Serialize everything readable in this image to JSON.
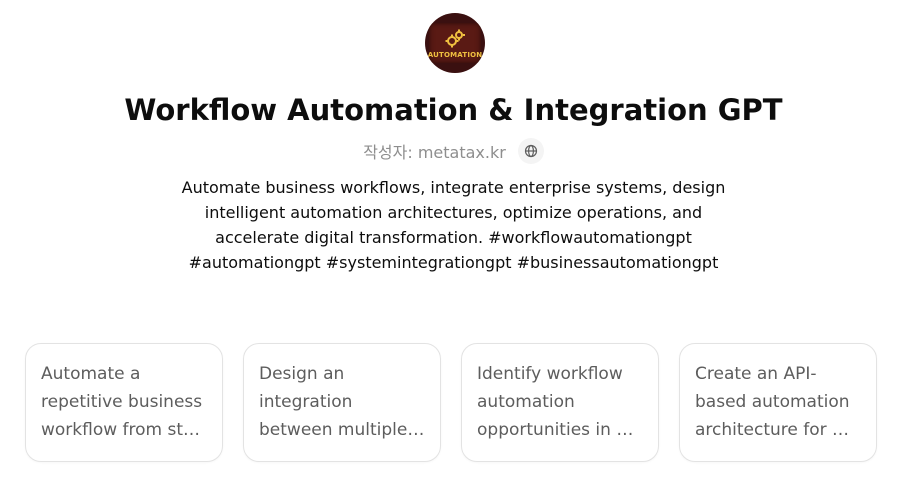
{
  "gpt": {
    "avatar_text": "AUTOMATION",
    "title": "Workflow Automation & Integration GPT",
    "author_label": "작성자: metatax.kr",
    "description": "Automate business workflows, integrate enterprise systems, design intelligent automation architectures, optimize operations, and accelerate digital transformation. #workflowautomationgpt #automationgpt #systemintegrationgpt #businessautomationgpt"
  },
  "starters": [
    {
      "label": "Automate a repetitive business workflow from start to finish"
    },
    {
      "label": "Design an integration between multiple systems"
    },
    {
      "label": "Identify workflow automation opportunities in my operations"
    },
    {
      "label": "Create an API-based automation architecture for my business"
    }
  ],
  "icons": {
    "avatar": "gears-icon",
    "author_link": "globe-icon"
  },
  "colors": {
    "title": "#0d0d0d",
    "muted": "#8e8e8e",
    "card_border": "#e3e3e3",
    "card_text": "#5d5d5d",
    "avatar_accent": "#f0c040"
  }
}
